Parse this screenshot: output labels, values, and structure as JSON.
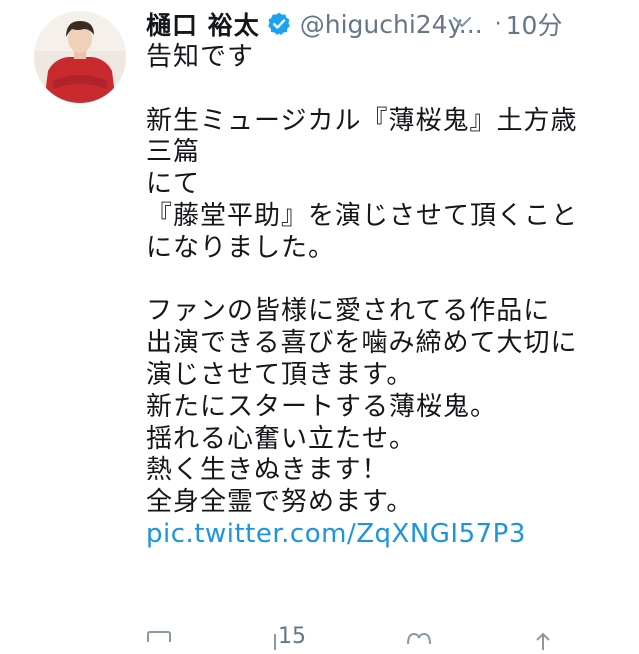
{
  "tweet": {
    "display_name": "樋口 裕太",
    "handle": "@higuchi24y...",
    "separator": "·",
    "time": "10分",
    "body_lines": [
      "告知です",
      "",
      "新生ミュージカル『薄桜鬼』土方歳",
      "三篇",
      "にて",
      "『藤堂平助』を演じさせて頂くこと",
      "になりました。",
      "",
      "ファンの皆様に愛されてる作品に",
      "出演できる喜びを噛み締めて大切に",
      "演じさせて頂きます。",
      "新たにスタートする薄桜鬼。",
      "揺れる心奮い立たせ。",
      "熱く生きぬきます！",
      "全身全霊で努めます。"
    ],
    "link": "pic.twitter.com/ZqXNGI57P3",
    "reply_count": "15"
  },
  "colors": {
    "text": "#14171a",
    "secondary": "#657786",
    "link": "#1b95e0",
    "verified": "#1da1f2",
    "avatar_shirt": "#c92a2e"
  },
  "icons": {
    "verified": "verified-badge-icon",
    "more": "chevron-down-icon",
    "reply": "reply-icon",
    "retweet": "retweet-icon",
    "like": "heart-icon",
    "share": "share-icon"
  }
}
